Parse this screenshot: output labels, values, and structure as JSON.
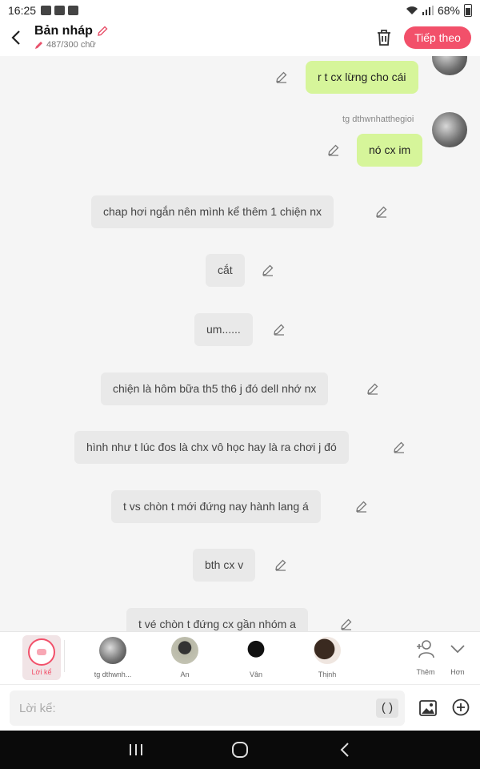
{
  "status_bar": {
    "time": "16:25",
    "battery": "68%"
  },
  "header": {
    "title": "Bản nháp",
    "word_count": "487/300 chữ",
    "next_label": "Tiếp theo"
  },
  "messages_right": [
    {
      "text": "r t cx lừng cho cái"
    },
    {
      "author": "tg dthwnhatthegioi",
      "text": "nó cx im"
    }
  ],
  "messages_center": [
    {
      "text": "chap hơi ngắn nên mình kể thêm 1 chiện nx"
    },
    {
      "text": "cắt"
    },
    {
      "text": "um......"
    },
    {
      "text": "chiện là hôm bữa th5 th6 j đó dell nhớ nx"
    },
    {
      "text": "hình như t lúc đos là chx vô học hay là ra chơi j đó"
    },
    {
      "text": "t vs chòn t mới đứng nay hành lang á"
    },
    {
      "text": "bth cx v"
    },
    {
      "text": "t vé chòn t đứng cx gần nhóm a"
    }
  ],
  "characters": {
    "narrator_label": "Lời kể",
    "items": [
      {
        "name": "tg dthwnh..."
      },
      {
        "name": "An"
      },
      {
        "name": "Vân"
      },
      {
        "name": "Thịnh"
      }
    ],
    "add_label": "Thêm",
    "more_label": "Hơn"
  },
  "input": {
    "placeholder": "Lời kể:",
    "paren_label": "( )"
  },
  "colors": {
    "accent": "#f2506a",
    "bubble_right": "#d6f59a",
    "bubble_center": "#e9e9e9"
  }
}
